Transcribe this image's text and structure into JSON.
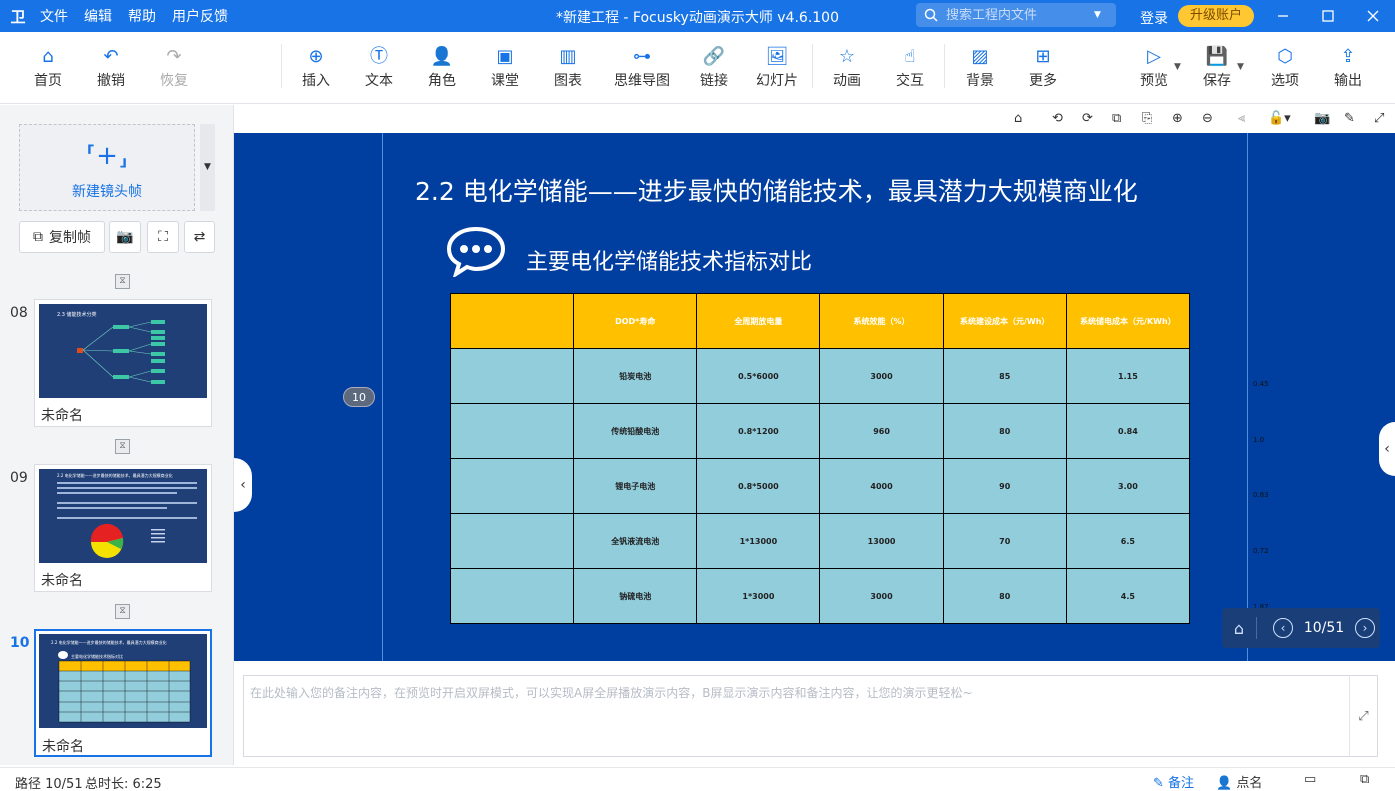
{
  "titlebar": {
    "logo": "卫",
    "menu": [
      "文件",
      "编辑",
      "帮助",
      "用户反馈"
    ],
    "title": "*新建工程 - Focusky动画演示大师  v4.6.100",
    "search_placeholder": "搜索工程内文件",
    "login": "登录",
    "upgrade": "升级账户"
  },
  "toolbar": {
    "home": "首页",
    "undo": "撤销",
    "redo": "恢复",
    "insert": "插入",
    "text": "文本",
    "role": "角色",
    "class": "课堂",
    "chart": "图表",
    "mindmap": "思维导图",
    "link": "链接",
    "slideshow": "幻灯片",
    "animation": "动画",
    "interact": "交互",
    "background": "背景",
    "more": "更多",
    "preview": "预览",
    "save": "保存",
    "options": "选项",
    "export": "输出"
  },
  "sidebar": {
    "new_frame": "新建镜头帧",
    "copy_frame": "复制帧",
    "slides": [
      {
        "num": "08",
        "name": "未命名",
        "thumb_title": "2.3 储能技术分类"
      },
      {
        "num": "09",
        "name": "未命名",
        "thumb_title": "2.2 电化学储能——进步最快的储能技术，最具潜力大规模商业化"
      },
      {
        "num": "10",
        "name": "未命名",
        "thumb_title": "2.2 电化学储能——进步最快的储能技术，最具潜力大规模商业化",
        "thumb_sub": "主要电化学储能技术指标对比"
      }
    ]
  },
  "slide": {
    "title": "2.2 电化学储能——进步最快的储能技术，最具潜力大规模商业化",
    "subtitle": "主要电化学储能技术指标对比",
    "frame_badge": "10",
    "header": [
      "",
      "DOD*寿命",
      "全周期放电量",
      "系统效能（%）",
      "系统建设成本（元/Wh）",
      "系统储电成本（元/KWh）"
    ],
    "rows": [
      [
        "",
        "铅炭电池",
        "0.5*6000",
        "3000",
        "85",
        "1.15"
      ],
      [
        "",
        "传统铅酸电池",
        "0.8*1200",
        "960",
        "80",
        "0.84"
      ],
      [
        "",
        "锂电子电池",
        "0.8*5000",
        "4000",
        "90",
        "3.00"
      ],
      [
        "",
        "全钒液流电池",
        "1*13000",
        "13000",
        "70",
        "6.5"
      ],
      [
        "",
        "钠硫电池",
        "1*3000",
        "3000",
        "80",
        "4.5"
      ]
    ],
    "outside_values": [
      "0.45",
      "1.0",
      "0.83",
      "0.72",
      "1.87"
    ]
  },
  "pager": {
    "text": "10/51"
  },
  "notes": {
    "placeholder": "在此处输入您的备注内容，在预览时开启双屏模式，可以实现A屏全屏播放演示内容，B屏显示演示内容和备注内容，让您的演示更轻松~"
  },
  "status": {
    "path": "路径 10/51",
    "duration": "总时长: 6:25",
    "notes": "备注",
    "roll_call": "点名"
  },
  "colors": {
    "accent": "#1773e6",
    "stage_bg": "#003fa0",
    "table_header": "#ffc000",
    "table_body": "#92cddc",
    "upgrade": "#ffc832"
  }
}
